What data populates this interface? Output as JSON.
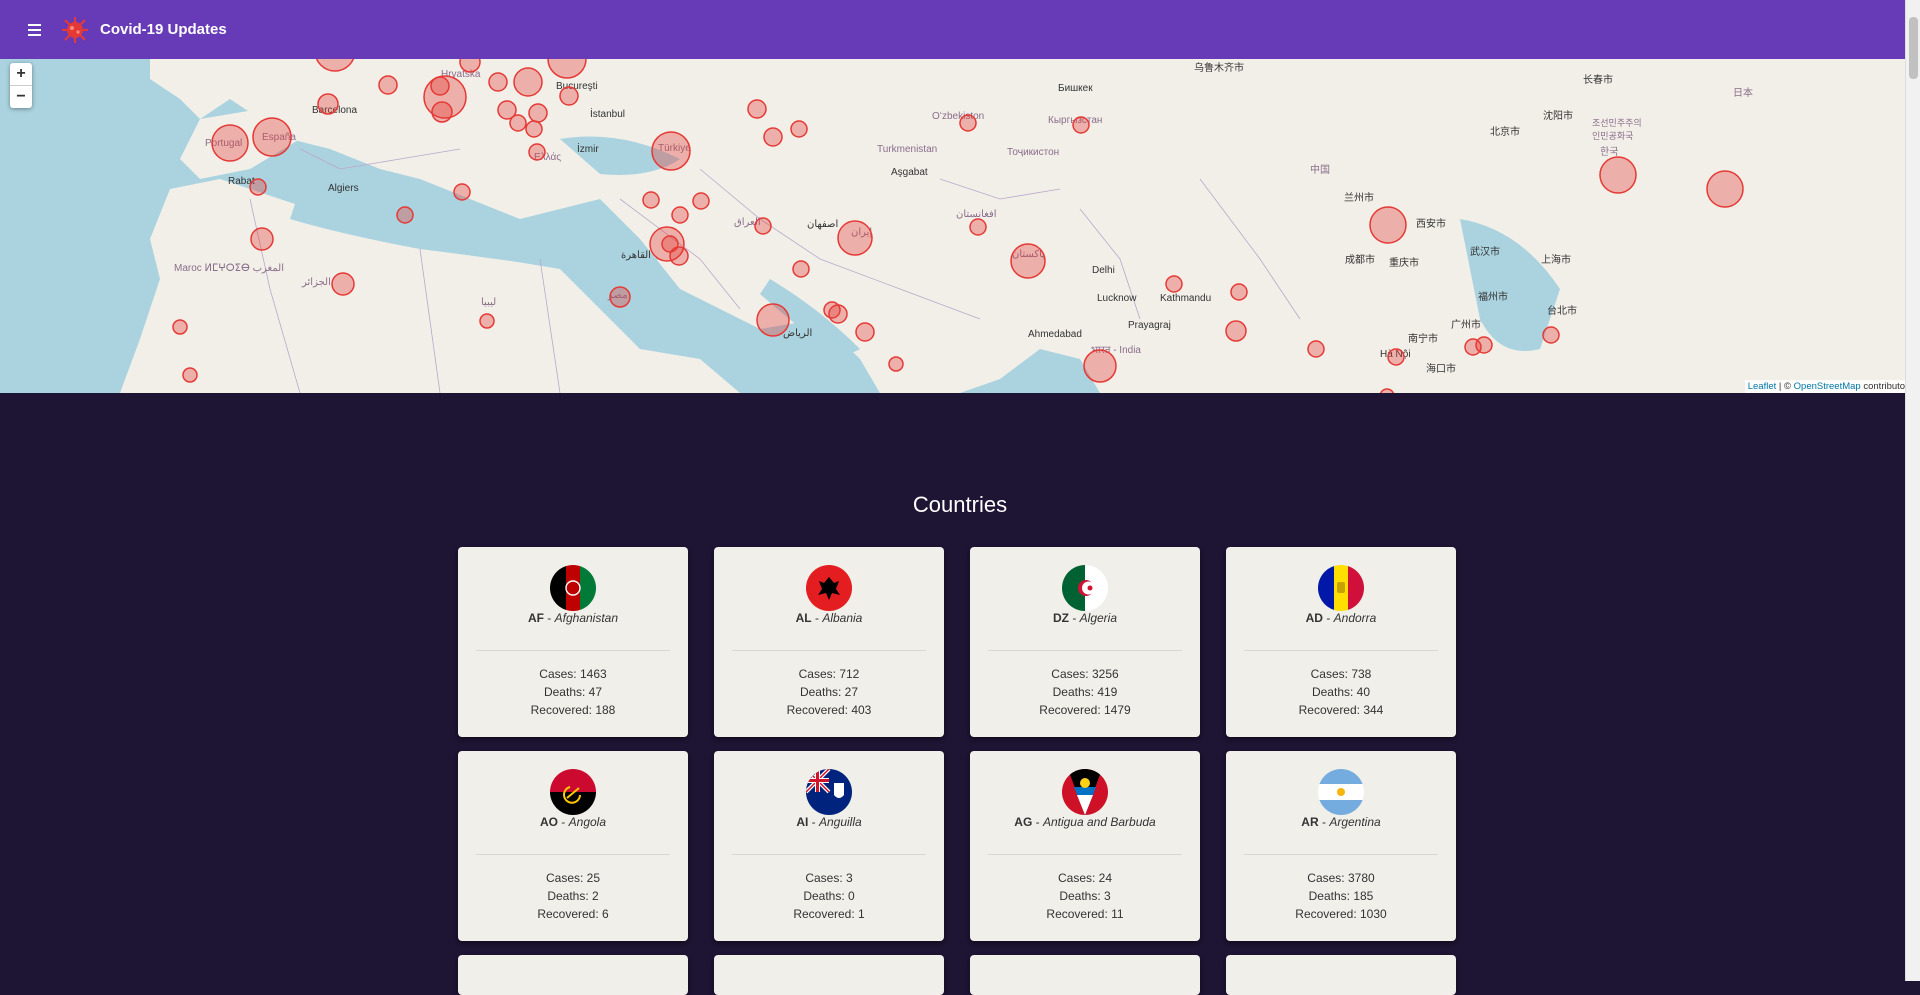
{
  "app": {
    "title": "Covid-19 Updates"
  },
  "map": {
    "zoom_in": "+",
    "zoom_out": "−",
    "attribution": {
      "leaflet": "Leaflet",
      "sep": "| ©",
      "osm": "OpenStreetMap",
      "suffix": "contributors"
    },
    "labels": [
      "Portugal",
      "España",
      "Barcelona",
      "Algiers",
      "Rabat",
      "Maroc ⵍⵎⵖⵔⵉⴱ المغرب",
      "Türkiye",
      "İzmir",
      "Bucureşti",
      "Hrvatska",
      "İstanbul",
      "Ελλάς",
      "ليبيا",
      "الجزائر",
      "مصر",
      "القاهرة",
      "العراق",
      "الرياض",
      "إيران",
      "اصفهان",
      "Turkmenistan",
      "Aşgabat",
      "Oʻzbekiston",
      "Бишкек",
      "Кыргызстан",
      "Тоҷикистон",
      "افغانستان",
      "پاکستان",
      "Delhi",
      "Lucknow",
      "Kathmandu",
      "Ahmedabad",
      "Prayagraj",
      "भारत - India",
      "中国",
      "兰州市",
      "西安市",
      "成都市",
      "重庆市",
      "武汉市",
      "上海市",
      "北京市",
      "沈阳市",
      "长春市",
      "乌鲁木齐市",
      "조선민주주의인민공화국",
      "한국",
      "日本",
      "Hà Nội",
      "海口市",
      "台北市",
      "福州市",
      "广州市",
      "南宁市"
    ]
  },
  "section": {
    "title": "Countries"
  },
  "countries": [
    {
      "code": "AF",
      "name": "Afghanistan",
      "cases": "Cases: 1463",
      "deaths": "Deaths: 47",
      "recovered": "Recovered: 188",
      "flag": "afghanistan-flag-icon"
    },
    {
      "code": "AL",
      "name": "Albania",
      "cases": "Cases: 712",
      "deaths": "Deaths: 27",
      "recovered": "Recovered: 403",
      "flag": "albania-flag-icon"
    },
    {
      "code": "DZ",
      "name": "Algeria",
      "cases": "Cases: 3256",
      "deaths": "Deaths: 419",
      "recovered": "Recovered: 1479",
      "flag": "algeria-flag-icon"
    },
    {
      "code": "AD",
      "name": "Andorra",
      "cases": "Cases: 738",
      "deaths": "Deaths: 40",
      "recovered": "Recovered: 344",
      "flag": "andorra-flag-icon"
    },
    {
      "code": "AO",
      "name": "Angola",
      "cases": "Cases: 25",
      "deaths": "Deaths: 2",
      "recovered": "Recovered: 6",
      "flag": "angola-flag-icon"
    },
    {
      "code": "AI",
      "name": "Anguilla",
      "cases": "Cases: 3",
      "deaths": "Deaths: 0",
      "recovered": "Recovered: 1",
      "flag": "anguilla-flag-icon"
    },
    {
      "code": "AG",
      "name": "Antigua and Barbuda",
      "cases": "Cases: 24",
      "deaths": "Deaths: 3",
      "recovered": "Recovered: 11",
      "flag": "antigua-flag-icon"
    },
    {
      "code": "AR",
      "name": "Argentina",
      "cases": "Cases: 3780",
      "deaths": "Deaths: 185",
      "recovered": "Recovered: 1030",
      "flag": "argentina-flag-icon"
    }
  ],
  "colors": {
    "toolbar": "#673ab7",
    "background": "#1e1433",
    "card": "#f0efe9",
    "marker": "#e53935"
  }
}
